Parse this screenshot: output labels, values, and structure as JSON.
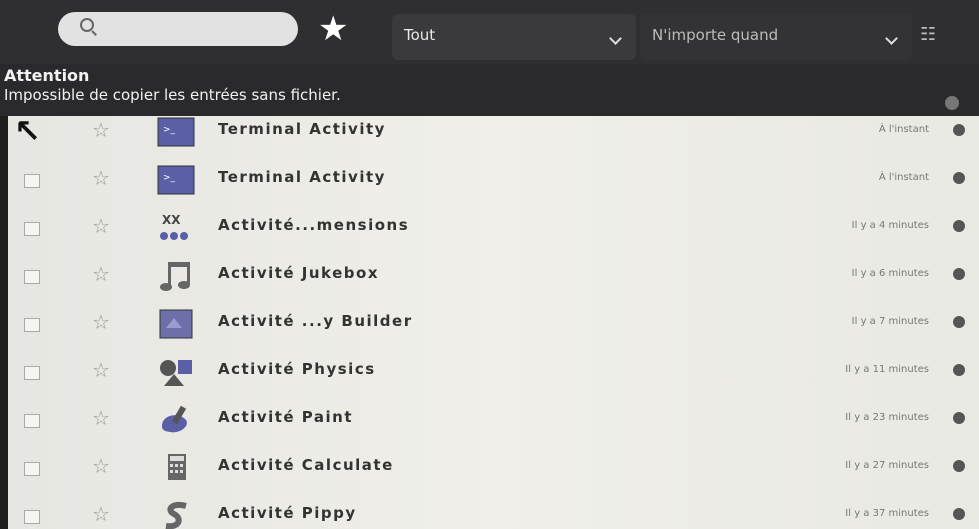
{
  "toolbar": {
    "search_placeholder": "",
    "filter_label": "Tout",
    "time_filter_label": "N'importe quand"
  },
  "alert": {
    "title": "Attention",
    "message": "Impossible de copier les entrées sans fichier."
  },
  "items": [
    {
      "name": "Terminal Activity",
      "when": "À l'instant",
      "icon": "terminal-icon"
    },
    {
      "name": "Terminal Activity",
      "when": "À l'instant",
      "icon": "terminal-icon"
    },
    {
      "name": "Activité...mensions",
      "when": "Il y a 4 minutes",
      "icon": "dimensions-icon"
    },
    {
      "name": "Activité Jukebox",
      "when": "Il y a 6 minutes",
      "icon": "music-icon"
    },
    {
      "name": "Activité ...y Builder",
      "when": "Il y a 7 minutes",
      "icon": "story-builder-icon"
    },
    {
      "name": "Activité Physics",
      "when": "Il y a 11 minutes",
      "icon": "physics-icon"
    },
    {
      "name": "Activité Paint",
      "when": "Il y a 23 minutes",
      "icon": "paint-icon"
    },
    {
      "name": "Activité Calculate",
      "when": "Il y a 27 minutes",
      "icon": "calculate-icon"
    },
    {
      "name": "Activité Pippy",
      "when": "Il y a 37 minutes",
      "icon": "pippy-icon"
    }
  ]
}
